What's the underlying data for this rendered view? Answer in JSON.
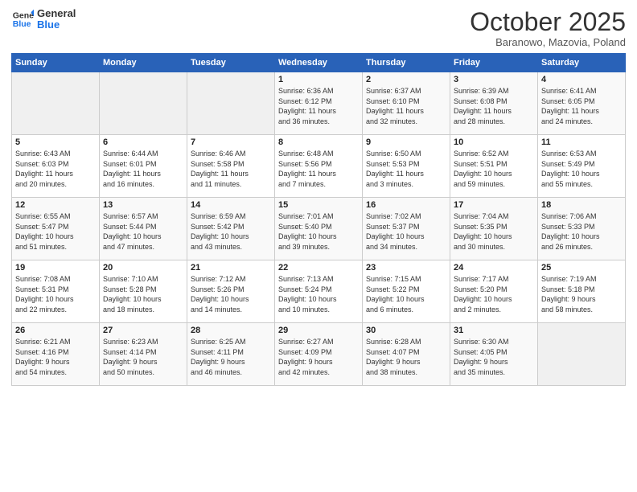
{
  "logo": {
    "line1": "General",
    "line2": "Blue"
  },
  "title": "October 2025",
  "location": "Baranowo, Mazovia, Poland",
  "days_of_week": [
    "Sunday",
    "Monday",
    "Tuesday",
    "Wednesday",
    "Thursday",
    "Friday",
    "Saturday"
  ],
  "weeks": [
    [
      {
        "day": "",
        "info": ""
      },
      {
        "day": "",
        "info": ""
      },
      {
        "day": "",
        "info": ""
      },
      {
        "day": "1",
        "info": "Sunrise: 6:36 AM\nSunset: 6:12 PM\nDaylight: 11 hours\nand 36 minutes."
      },
      {
        "day": "2",
        "info": "Sunrise: 6:37 AM\nSunset: 6:10 PM\nDaylight: 11 hours\nand 32 minutes."
      },
      {
        "day": "3",
        "info": "Sunrise: 6:39 AM\nSunset: 6:08 PM\nDaylight: 11 hours\nand 28 minutes."
      },
      {
        "day": "4",
        "info": "Sunrise: 6:41 AM\nSunset: 6:05 PM\nDaylight: 11 hours\nand 24 minutes."
      }
    ],
    [
      {
        "day": "5",
        "info": "Sunrise: 6:43 AM\nSunset: 6:03 PM\nDaylight: 11 hours\nand 20 minutes."
      },
      {
        "day": "6",
        "info": "Sunrise: 6:44 AM\nSunset: 6:01 PM\nDaylight: 11 hours\nand 16 minutes."
      },
      {
        "day": "7",
        "info": "Sunrise: 6:46 AM\nSunset: 5:58 PM\nDaylight: 11 hours\nand 11 minutes."
      },
      {
        "day": "8",
        "info": "Sunrise: 6:48 AM\nSunset: 5:56 PM\nDaylight: 11 hours\nand 7 minutes."
      },
      {
        "day": "9",
        "info": "Sunrise: 6:50 AM\nSunset: 5:53 PM\nDaylight: 11 hours\nand 3 minutes."
      },
      {
        "day": "10",
        "info": "Sunrise: 6:52 AM\nSunset: 5:51 PM\nDaylight: 10 hours\nand 59 minutes."
      },
      {
        "day": "11",
        "info": "Sunrise: 6:53 AM\nSunset: 5:49 PM\nDaylight: 10 hours\nand 55 minutes."
      }
    ],
    [
      {
        "day": "12",
        "info": "Sunrise: 6:55 AM\nSunset: 5:47 PM\nDaylight: 10 hours\nand 51 minutes."
      },
      {
        "day": "13",
        "info": "Sunrise: 6:57 AM\nSunset: 5:44 PM\nDaylight: 10 hours\nand 47 minutes."
      },
      {
        "day": "14",
        "info": "Sunrise: 6:59 AM\nSunset: 5:42 PM\nDaylight: 10 hours\nand 43 minutes."
      },
      {
        "day": "15",
        "info": "Sunrise: 7:01 AM\nSunset: 5:40 PM\nDaylight: 10 hours\nand 39 minutes."
      },
      {
        "day": "16",
        "info": "Sunrise: 7:02 AM\nSunset: 5:37 PM\nDaylight: 10 hours\nand 34 minutes."
      },
      {
        "day": "17",
        "info": "Sunrise: 7:04 AM\nSunset: 5:35 PM\nDaylight: 10 hours\nand 30 minutes."
      },
      {
        "day": "18",
        "info": "Sunrise: 7:06 AM\nSunset: 5:33 PM\nDaylight: 10 hours\nand 26 minutes."
      }
    ],
    [
      {
        "day": "19",
        "info": "Sunrise: 7:08 AM\nSunset: 5:31 PM\nDaylight: 10 hours\nand 22 minutes."
      },
      {
        "day": "20",
        "info": "Sunrise: 7:10 AM\nSunset: 5:28 PM\nDaylight: 10 hours\nand 18 minutes."
      },
      {
        "day": "21",
        "info": "Sunrise: 7:12 AM\nSunset: 5:26 PM\nDaylight: 10 hours\nand 14 minutes."
      },
      {
        "day": "22",
        "info": "Sunrise: 7:13 AM\nSunset: 5:24 PM\nDaylight: 10 hours\nand 10 minutes."
      },
      {
        "day": "23",
        "info": "Sunrise: 7:15 AM\nSunset: 5:22 PM\nDaylight: 10 hours\nand 6 minutes."
      },
      {
        "day": "24",
        "info": "Sunrise: 7:17 AM\nSunset: 5:20 PM\nDaylight: 10 hours\nand 2 minutes."
      },
      {
        "day": "25",
        "info": "Sunrise: 7:19 AM\nSunset: 5:18 PM\nDaylight: 9 hours\nand 58 minutes."
      }
    ],
    [
      {
        "day": "26",
        "info": "Sunrise: 6:21 AM\nSunset: 4:16 PM\nDaylight: 9 hours\nand 54 minutes."
      },
      {
        "day": "27",
        "info": "Sunrise: 6:23 AM\nSunset: 4:14 PM\nDaylight: 9 hours\nand 50 minutes."
      },
      {
        "day": "28",
        "info": "Sunrise: 6:25 AM\nSunset: 4:11 PM\nDaylight: 9 hours\nand 46 minutes."
      },
      {
        "day": "29",
        "info": "Sunrise: 6:27 AM\nSunset: 4:09 PM\nDaylight: 9 hours\nand 42 minutes."
      },
      {
        "day": "30",
        "info": "Sunrise: 6:28 AM\nSunset: 4:07 PM\nDaylight: 9 hours\nand 38 minutes."
      },
      {
        "day": "31",
        "info": "Sunrise: 6:30 AM\nSunset: 4:05 PM\nDaylight: 9 hours\nand 35 minutes."
      },
      {
        "day": "",
        "info": ""
      }
    ]
  ]
}
